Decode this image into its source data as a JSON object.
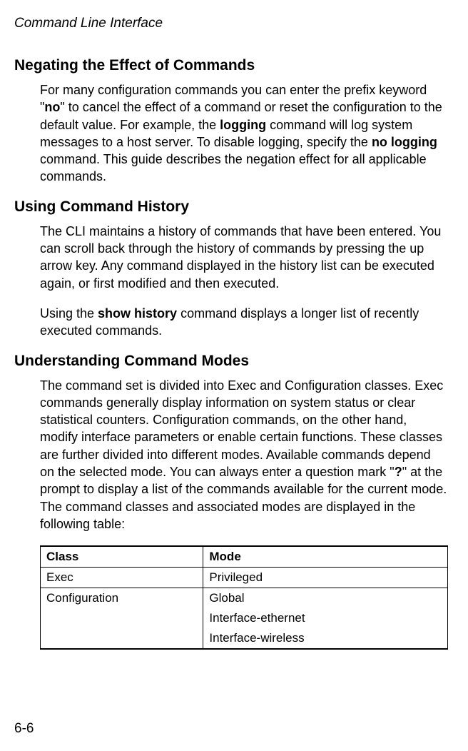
{
  "header": "Command Line Interface",
  "sections": {
    "negating": {
      "title": "Negating the Effect of Commands",
      "p1_part1": "For many configuration commands you can enter the prefix keyword \"",
      "p1_bold1": "no",
      "p1_part2": "\" to cancel the effect of a command or reset the configuration to the default value. For example, the ",
      "p1_bold2": "logging",
      "p1_part3": " command will log system messages to a host server. To disable logging, specify the ",
      "p1_bold3": "no logging",
      "p1_part4": " command. This guide describes the negation effect for all applicable commands."
    },
    "history": {
      "title": "Using Command History",
      "p1": "The CLI maintains a history of commands that have been entered. You can scroll back through the history of commands by pressing the up arrow key. Any command displayed in the history list can be executed again, or first modified and then executed.",
      "p2_part1": "Using the ",
      "p2_bold1": "show history",
      "p2_part2": " command displays a longer list of recently executed commands."
    },
    "modes": {
      "title": "Understanding Command Modes",
      "p1_part1": "The command set is divided into Exec and Configuration classes. Exec commands generally display information on system status or clear statistical counters. Configuration commands, on the other hand, modify interface parameters or enable certain functions. These classes are further divided into different modes. Available commands depend on the selected mode. You can always enter a question mark \"",
      "p1_bold1": "?",
      "p1_part2": "\" at the prompt to display a list of the commands available for the current mode. The command classes and associated modes are displayed in the following table:"
    }
  },
  "table": {
    "headers": {
      "class": "Class",
      "mode": "Mode"
    },
    "rows": {
      "exec_class": "Exec",
      "exec_mode": "Privileged",
      "config_class": "Configuration",
      "config_mode1": "Global",
      "config_mode2": "Interface-ethernet",
      "config_mode3": "Interface-wireless"
    }
  },
  "page_number": "6-6"
}
